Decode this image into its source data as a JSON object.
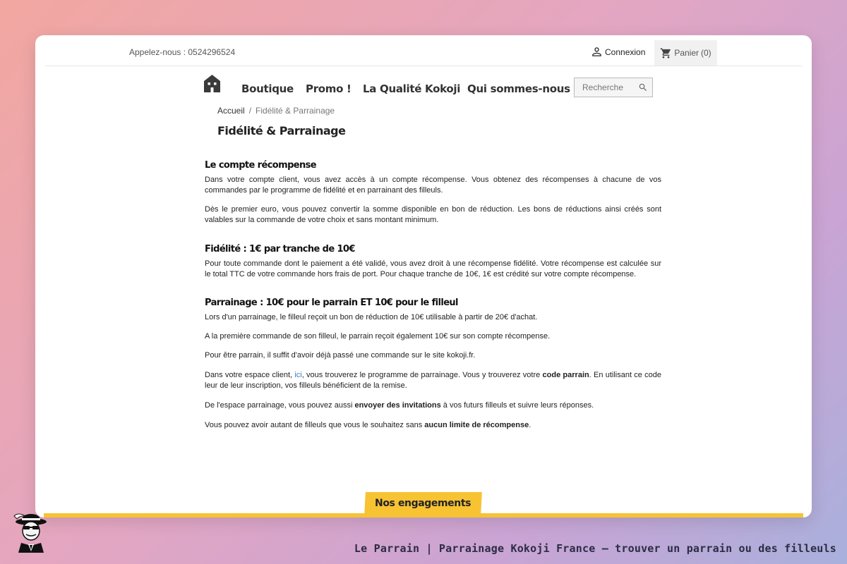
{
  "header": {
    "phone": "Appelez-nous : 0524296524",
    "login_label": "Connexion",
    "cart_label": "Panier",
    "cart_count": "(0)"
  },
  "nav": {
    "items": [
      "Boutique",
      "Promo !",
      "La Qualité Kokoji",
      "Qui sommes-nous ?"
    ],
    "search_placeholder": "Recherche"
  },
  "breadcrumb": {
    "home": "Accueil",
    "separator": "/",
    "current": "Fidélité & Parrainage"
  },
  "page": {
    "title": "Fidélité & Parrainage",
    "sections": [
      {
        "heading": "Le compte récompense",
        "paragraphs": [
          "Dans votre compte client, vous avez accès à un compte récompense. Vous obtenez des récompenses à chacune de vos commandes par le programme de fidélité et en parrainant des filleuls.",
          "Dès le premier euro, vous pouvez convertir la somme disponible en bon de réduction. Les bons de réductions ainsi créés sont valables sur la commande de votre choix et sans montant minimum."
        ]
      },
      {
        "heading": "Fidélité : 1€ par tranche de 10€",
        "paragraphs": [
          "Pour toute commande dont le paiement a été validé, vous avez droit à une récompense fidélité. Votre récompense est calculée sur le total TTC de votre commande hors frais de port. Pour chaque tranche de 10€, 1€ est crédité sur votre compte récompense."
        ]
      },
      {
        "heading": "Parrainage : 10€ pour le parrain ET 10€ pour le filleul",
        "p1": "Lors d'un parrainage, le filleul reçoit un bon de réduction de 10€ utilisable à partir de 20€ d'achat.",
        "p2": "A la première commande de son filleul, le parrain reçoit également 10€ sur son compte récompense.",
        "p3": "Pour être parrain, il suffit d'avoir déjà passé une commande sur le site kokoji.fr.",
        "p4_a": "Dans votre espace client, ",
        "p4_link": "ici",
        "p4_b": ", vous trouverez le programme de parrainage. Vous y trouverez votre ",
        "p4_bold": "code parrain",
        "p4_c": ". En utilisant ce code leur de leur inscription, vos filleuls bénéficient de la remise.",
        "p5_a": "De l'espace parrainage, vous pouvez aussi ",
        "p5_bold": "envoyer des invitations",
        "p5_b": " à vos futurs filleuls et suivre leurs réponses.",
        "p6_a": "Vous pouvez avoir autant de filleuls que vous le souhaitez sans ",
        "p6_bold": "aucun limite de récompense",
        "p6_b": "."
      }
    ]
  },
  "footer": {
    "tab_label": "Nos engagements",
    "caption": "Le Parrain | Parrainage Kokoji France — trouver un parrain ou des filleuls"
  },
  "colors": {
    "accent_yellow": "#f7c333",
    "link": "#3a7bbf"
  },
  "icons": {
    "login": "person-icon",
    "cart": "cart-icon",
    "search": "search-icon",
    "logo": "house-logo-icon",
    "mascot": "mascot-gangster-icon"
  }
}
